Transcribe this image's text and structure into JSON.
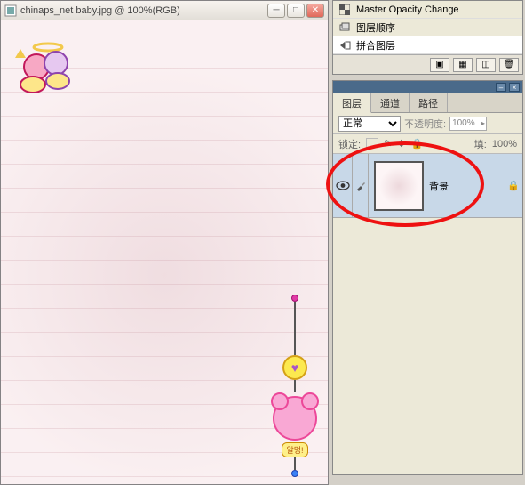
{
  "document": {
    "title": "chinaps_net baby.jpg @ 100%(RGB)",
    "charm_tag": "알멍!"
  },
  "history": {
    "items": [
      {
        "icon": "opacity-icon",
        "label": "Master Opacity Change"
      },
      {
        "icon": "layers-icon",
        "label": "图层顺序"
      },
      {
        "icon": "merge-icon",
        "label": "拼合图层"
      }
    ]
  },
  "layers_panel": {
    "tabs": {
      "layers": "图层",
      "channels": "通道",
      "paths": "路径"
    },
    "blend_mode": "正常",
    "opacity_label": "不透明度:",
    "opacity_value": "100%",
    "lock_label": "锁定:",
    "fill_label": "填:",
    "fill_value": "100%",
    "layer": {
      "name": "背景",
      "visible": true,
      "locked": true
    }
  }
}
